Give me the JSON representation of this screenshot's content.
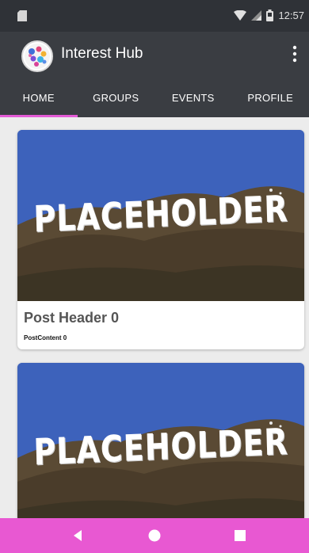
{
  "status_bar": {
    "time": "12:57",
    "icons": [
      "sd-card-icon",
      "wifi-icon",
      "signal-icon",
      "battery-icon"
    ]
  },
  "app_bar": {
    "title": "Interest Hub",
    "logo": "interest-hub-logo",
    "menu_icon": "more-vert-icon"
  },
  "tabs": [
    {
      "label": "HOME",
      "active": true
    },
    {
      "label": "GROUPS",
      "active": false
    },
    {
      "label": "EVENTS",
      "active": false
    },
    {
      "label": "PROFILE",
      "active": false
    }
  ],
  "posts": [
    {
      "image_text": "PLACEHOLDER",
      "header": "Post Header 0",
      "content": "PostContent 0"
    },
    {
      "image_text": "PLACEHOLDER"
    }
  ],
  "nav_bar": {
    "buttons": [
      "back-icon",
      "home-icon",
      "recents-icon"
    ]
  },
  "colors": {
    "app_bar": "#3a3d42",
    "status_bar": "#2f3237",
    "tab_indicator": "#e35ad6",
    "nav_bar": "#e858d2",
    "feed_background": "#ececec"
  }
}
